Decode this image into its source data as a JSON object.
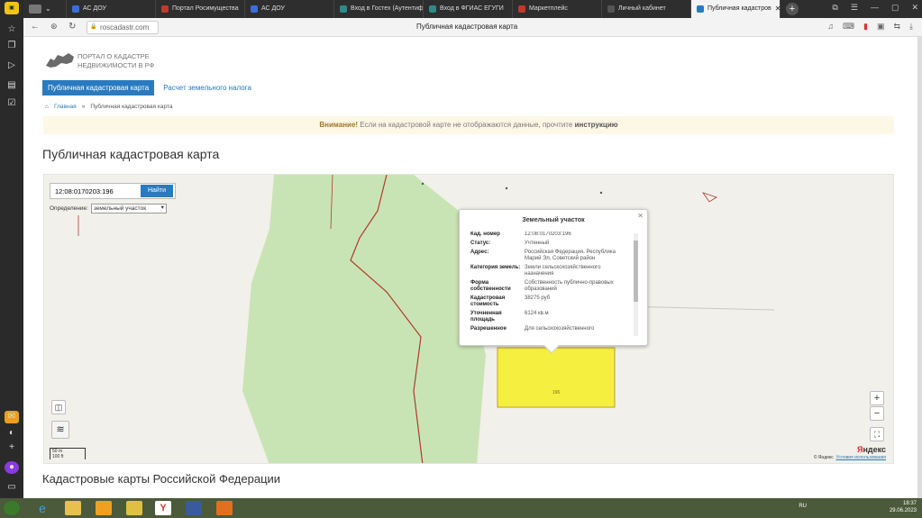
{
  "browser": {
    "tabs": [
      {
        "label": "АС ДОУ",
        "color": "#3a6fd8"
      },
      {
        "label": "Портал Росимущества",
        "color": "#c0392b"
      },
      {
        "label": "АС ДОУ",
        "color": "#3a6fd8"
      },
      {
        "label": "Вход в Гостех (Аутентиф",
        "color": "#2b8a8a"
      },
      {
        "label": "Вход в ФГИАС ЕГУГИ",
        "color": "#2b8a8a"
      },
      {
        "label": "Маркетплейс",
        "color": "#c0392b"
      },
      {
        "label": "Личный кабинет",
        "color": "#555555"
      },
      {
        "label": "Публичная кадастров",
        "color": "#2a7abf"
      }
    ],
    "url": "roscadastr.com",
    "page_title": "Публичная кадастровая карта"
  },
  "site": {
    "logo_line1": "ПОРТАЛ О КАДАСТРЕ",
    "logo_line2": "НЕДВИЖИМОСТИ В РФ",
    "tab_map": "Публичная кадастровая карта",
    "tab_tax": "Расчет земельного налога",
    "breadcrumb_home": "Главная",
    "breadcrumb_sep": "»",
    "breadcrumb_current": "Публичная кадастровая карта",
    "alert_bold": "Внимание!",
    "alert_text": " Если на кадастровой карте не отображаются данные, прочтите ",
    "alert_link": "инструкцию",
    "heading": "Публичная кадастровая карта",
    "heading2": "Кадастровые карты Российской Федерации"
  },
  "map": {
    "search_value": "12:08:0170203:196",
    "search_button": "Найти",
    "def_label": "Определение:",
    "def_value": "земельный участок",
    "parcel_label": "196",
    "scale_m": "50 m",
    "scale_ft": "100 ft",
    "yandex_part1": "Я",
    "yandex_part2": "ндекс",
    "copyright": "© Яндекс",
    "terms": "Условия использования",
    "zoom_in": "+",
    "zoom_out": "−",
    "colors": {
      "forest": "#c9e4b4",
      "parcel": "#f5ef3f",
      "boundary": "#b03a2e"
    }
  },
  "popup": {
    "title": "Земельный участок",
    "rows": [
      {
        "label": "Кад. номер",
        "value": "12:08:0170203:196"
      },
      {
        "label": "Статус:",
        "value": "Учтенный"
      },
      {
        "label": "Адрес:",
        "value": "Российская Федерация, Республика Марий Эл, Советский район"
      },
      {
        "label": "Категория земель:",
        "value": "Земли сельскохозяйственного назначения"
      },
      {
        "label": "Форма собственности",
        "value": "Собственность публично-правовых образований"
      },
      {
        "label": "Кадастровая стоимость",
        "value": "38275 руб"
      },
      {
        "label": "Уточненная площадь",
        "value": "6124 кв.м"
      },
      {
        "label": "Разрешенное",
        "value": "Для сельскохозяйственного"
      }
    ]
  },
  "taskbar": {
    "lang": "RU",
    "time": "18:37",
    "date": "29.06.2023"
  }
}
